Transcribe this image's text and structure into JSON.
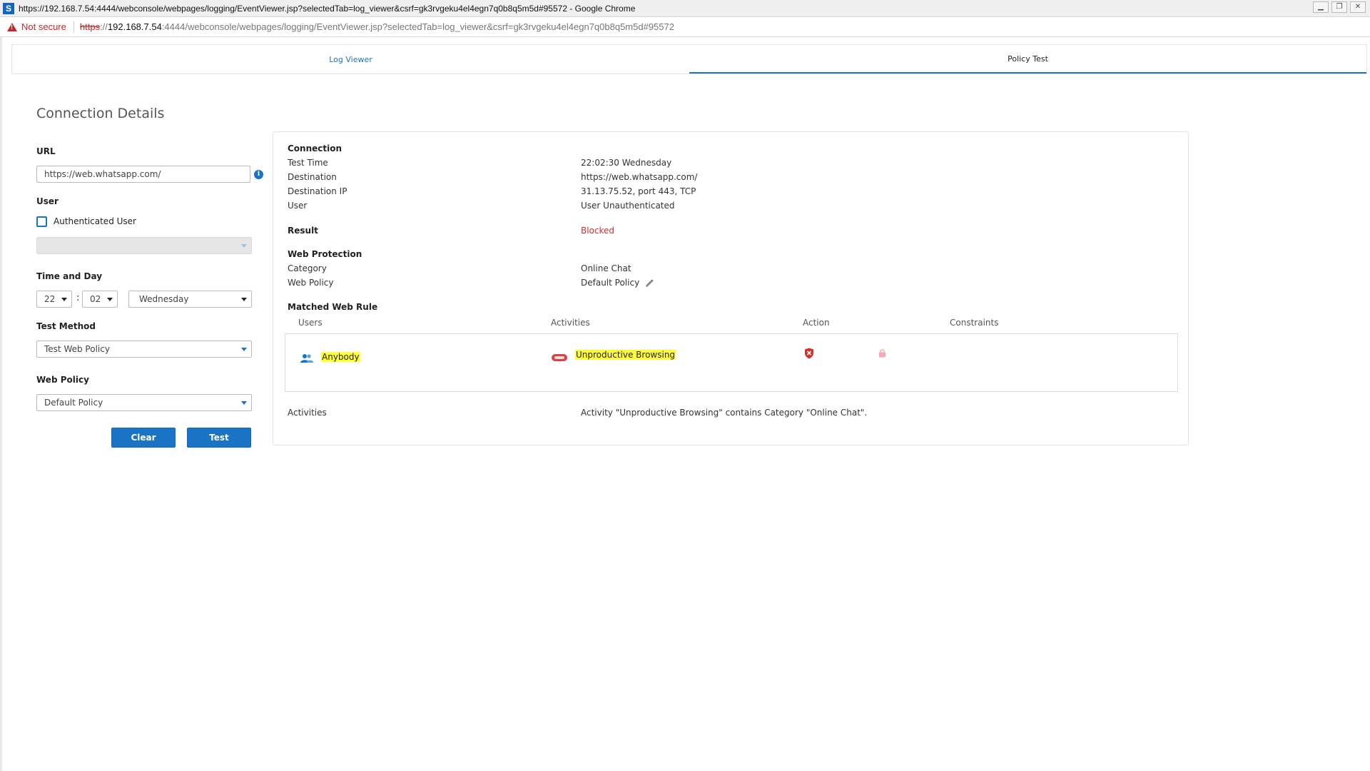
{
  "window": {
    "title": "https://192.168.7.54:4444/webconsole/webpages/logging/EventViewer.jsp?selectedTab=log_viewer&csrf=gk3rvgeku4el4egn7q0b8q5m5d#95572 - Google Chrome",
    "app_icon_letter": "S"
  },
  "addressbar": {
    "security_label": "Not secure",
    "url_scheme": "https",
    "url_sep": "://",
    "url_host": "192.168.7.54",
    "url_rest": ":4444/webconsole/webpages/logging/EventViewer.jsp?selectedTab=log_viewer&csrf=gk3rvgeku4el4egn7q0b8q5m5d#95572"
  },
  "tabs": [
    {
      "label": "Log Viewer",
      "active": false
    },
    {
      "label": "Policy Test",
      "active": true
    }
  ],
  "page_title": "Connection Details",
  "form": {
    "url_label": "URL",
    "url_value": "https://web.whatsapp.com/",
    "user_label": "User",
    "auth_user_label": "Authenticated User",
    "user_select_value": "",
    "time_label": "Time and Day",
    "hour": "22",
    "colon": ":",
    "minute": "02",
    "day": "Wednesday",
    "test_method_label": "Test Method",
    "test_method_value": "Test Web Policy",
    "web_policy_label": "Web Policy",
    "web_policy_value": "Default Policy",
    "clear_label": "Clear",
    "test_label": "Test"
  },
  "result": {
    "connection_heading": "Connection",
    "test_time_label": "Test Time",
    "test_time_value": "22:02:30 Wednesday",
    "destination_label": "Destination",
    "destination_value": "https://web.whatsapp.com/",
    "dest_ip_label": "Destination IP",
    "dest_ip_value": "31.13.75.52, port 443, TCP",
    "user_label": "User",
    "user_value": "User Unauthenticated",
    "result_label": "Result",
    "result_value": "Blocked",
    "web_protection_heading": "Web Protection",
    "category_label": "Category",
    "category_value": "Online Chat",
    "web_policy_label": "Web Policy",
    "web_policy_value": "Default Policy",
    "matched_rule_heading": "Matched Web Rule",
    "columns": {
      "users": "Users",
      "activities": "Activities",
      "action": "Action",
      "constraints": "Constraints"
    },
    "rule": {
      "users": "Anybody",
      "activities": "Unproductive Browsing"
    },
    "activities_label": "Activities",
    "activities_value": "Activity \"Unproductive Browsing\" contains Category \"Online Chat\"."
  },
  "colors": {
    "accent": "#1a73c5",
    "blocked": "#d32f2f",
    "highlight": "#ffff33"
  }
}
